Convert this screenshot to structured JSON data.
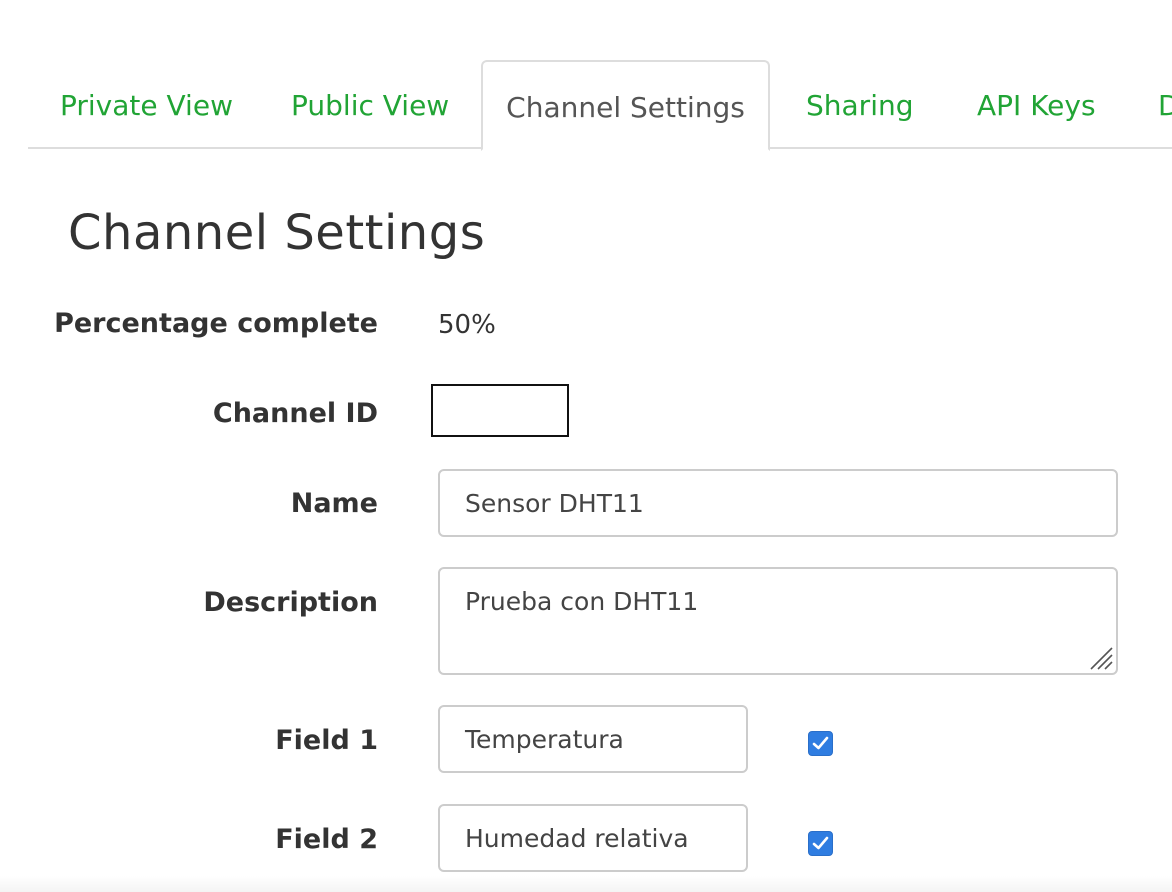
{
  "tabs": [
    {
      "label": "Private View",
      "active": false
    },
    {
      "label": "Public View",
      "active": false
    },
    {
      "label": "Channel Settings",
      "active": true
    },
    {
      "label": "Sharing",
      "active": false
    },
    {
      "label": "API Keys",
      "active": false
    },
    {
      "label": "D",
      "active": false
    }
  ],
  "page_title": "Channel Settings",
  "form": {
    "percentage_label": "Percentage complete",
    "percentage_value": "50%",
    "channel_id_label": "Channel ID",
    "name_label": "Name",
    "name_value": "Sensor DHT11",
    "description_label": "Description",
    "description_value": "Prueba con DHT11",
    "fields": [
      {
        "label": "Field 1",
        "value": "Temperatura",
        "checked": true
      },
      {
        "label": "Field 2",
        "value": "Humedad relativa",
        "checked": true
      }
    ]
  },
  "colors": {
    "link_green": "#21a435",
    "checkbox_blue": "#2f7de1",
    "border_gray": "#cccccc"
  }
}
